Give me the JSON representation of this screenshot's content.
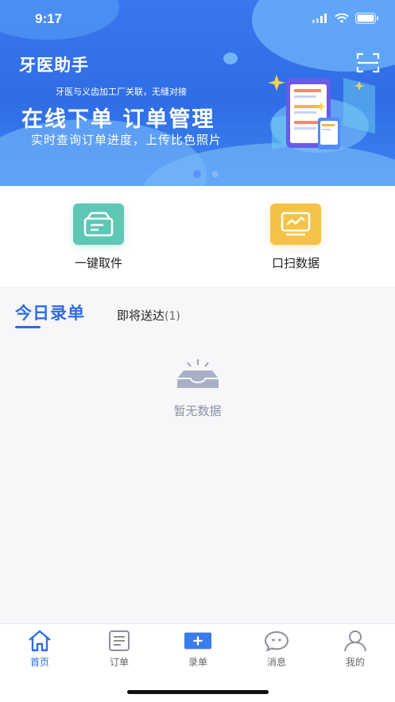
{
  "status_bar": {
    "time": "9:17"
  },
  "banner": {
    "app_title": "牙医助手",
    "tagline": "牙医与义齿加工厂关联，无缝对接",
    "headline": "在线下单  订单管理",
    "subline": "实时查询订单进度，上传比色照片",
    "carousel_pages": 2,
    "active_page": 1
  },
  "quick_actions": [
    {
      "label": "一键取件",
      "color": "#5ec8b4"
    },
    {
      "label": "口扫数据",
      "color": "#f4c246"
    }
  ],
  "tabs": {
    "today": "今日录单",
    "upcoming": "即将送达",
    "upcoming_count": "(1)"
  },
  "empty_state": {
    "message": "暂无数据"
  },
  "bottom_nav": [
    {
      "label": "首页",
      "icon": "home-icon",
      "active": true
    },
    {
      "label": "订单",
      "icon": "order-list-icon",
      "active": false
    },
    {
      "label": "录单",
      "icon": "add-order-icon",
      "active": false
    },
    {
      "label": "消息",
      "icon": "message-icon",
      "active": false
    },
    {
      "label": "我的",
      "icon": "profile-icon",
      "active": false
    }
  ],
  "colors": {
    "primary": "#2f6de6",
    "inactive": "#666666"
  }
}
